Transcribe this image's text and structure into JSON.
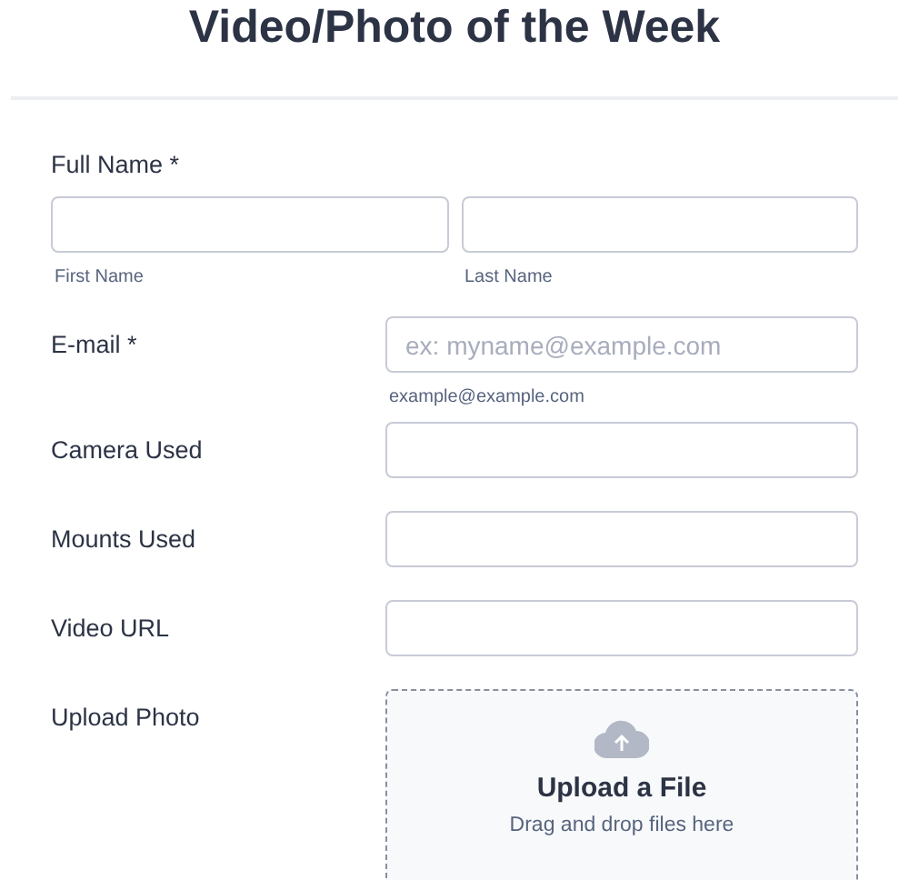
{
  "title": "Video/Photo of the Week",
  "fields": [
    {
      "kind": "name",
      "label": "Full Name *",
      "parts": [
        {
          "sublabel": "First Name"
        },
        {
          "sublabel": "Last Name"
        }
      ]
    },
    {
      "kind": "text",
      "label": "E-mail *",
      "placeholder": "ex: myname@example.com",
      "sublabel": "example@example.com"
    },
    {
      "kind": "text",
      "label": "Camera Used"
    },
    {
      "kind": "text",
      "label": "Mounts Used"
    },
    {
      "kind": "text",
      "label": "Video URL"
    },
    {
      "kind": "upload",
      "label": "Upload Photo",
      "heading": "Upload a File",
      "hint": "Drag and drop files here"
    }
  ]
}
